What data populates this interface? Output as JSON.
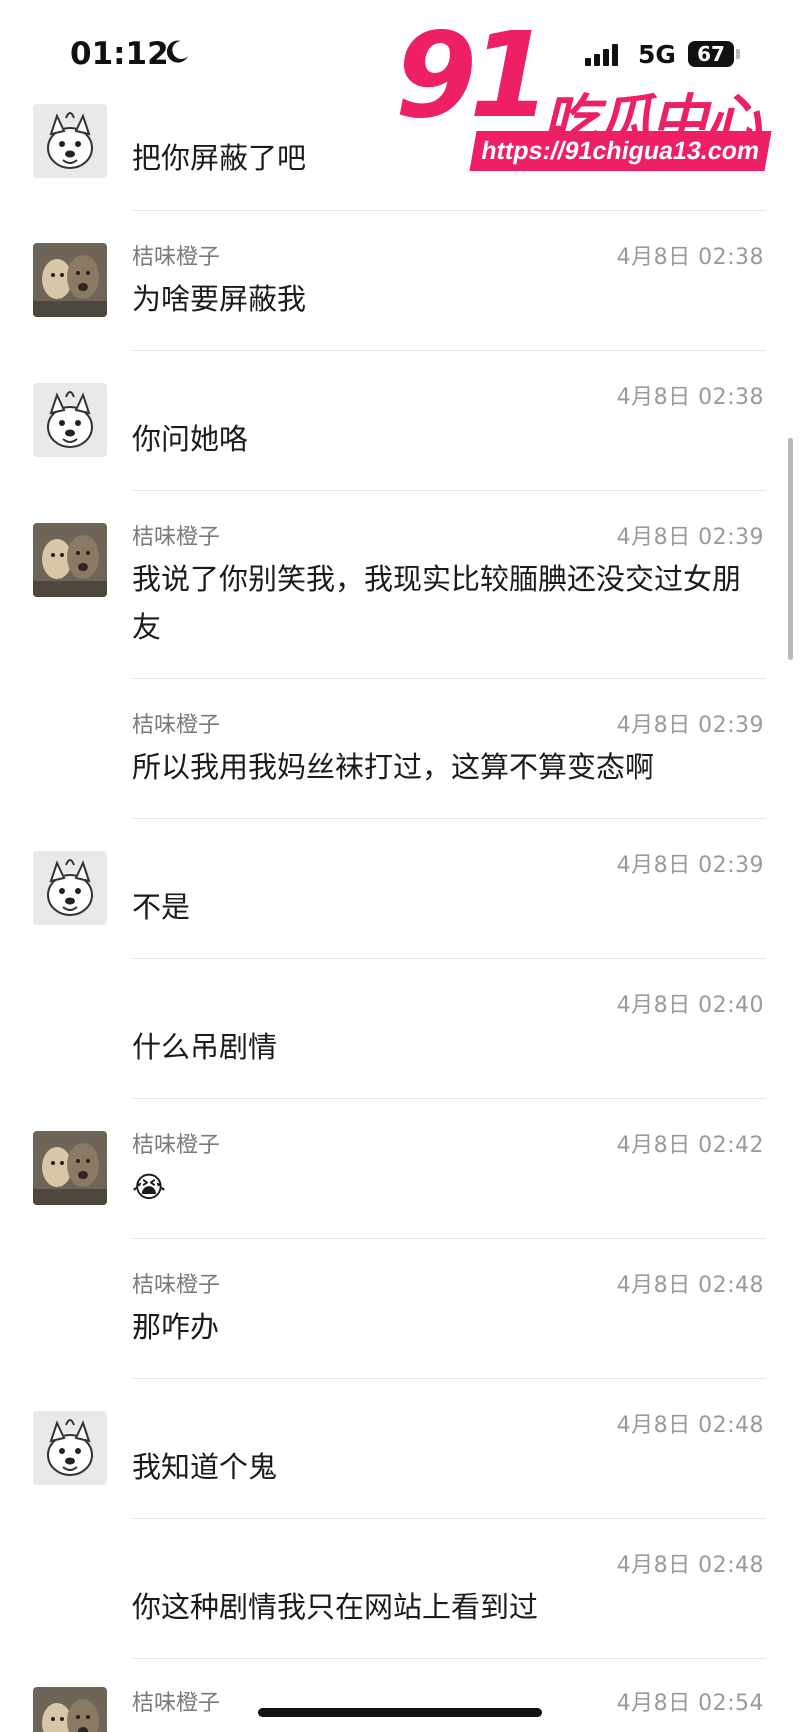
{
  "status": {
    "time": "01:12",
    "network": "5G",
    "battery": "67"
  },
  "watermark": {
    "brand_number": "91",
    "brand_cn": "吃瓜中心",
    "url": "https://91chigua13.com"
  },
  "messages": [
    {
      "avatar": "cartoon-dog-avatar",
      "sender": "",
      "time": "",
      "text": "把你屏蔽了吧"
    },
    {
      "avatar": "dog-photo-avatar",
      "sender": "桔味橙子",
      "time": "4月8日 02:38",
      "text": "为啥要屏蔽我"
    },
    {
      "avatar": "cartoon-dog-avatar",
      "sender": "",
      "time": "4月8日 02:38",
      "text": "你问她咯"
    },
    {
      "avatar": "dog-photo-avatar",
      "sender": "桔味橙子",
      "time": "4月8日 02:39",
      "text": "我说了你别笑我，我现实比较腼腆还没交过女朋友"
    },
    {
      "avatar": "",
      "sender": "桔味橙子",
      "time": "4月8日 02:39",
      "text": "所以我用我妈丝袜打过，这算不算变态啊"
    },
    {
      "avatar": "cartoon-dog-avatar",
      "sender": "",
      "time": "4月8日 02:39",
      "text": "不是"
    },
    {
      "avatar": "",
      "sender": "",
      "time": "4月8日 02:40",
      "text": "什么吊剧情"
    },
    {
      "avatar": "dog-photo-avatar",
      "sender": "桔味橙子",
      "time": "4月8日 02:42",
      "text": "😭"
    },
    {
      "avatar": "",
      "sender": "桔味橙子",
      "time": "4月8日 02:48",
      "text": "那咋办"
    },
    {
      "avatar": "cartoon-dog-avatar",
      "sender": "",
      "time": "4月8日 02:48",
      "text": "我知道个鬼"
    },
    {
      "avatar": "",
      "sender": "",
      "time": "4月8日 02:48",
      "text": "你这种剧情我只在网站上看到过"
    },
    {
      "avatar": "dog-photo-avatar",
      "sender": "桔味橙子",
      "time": "4月8日 02:54",
      "text": ""
    }
  ]
}
